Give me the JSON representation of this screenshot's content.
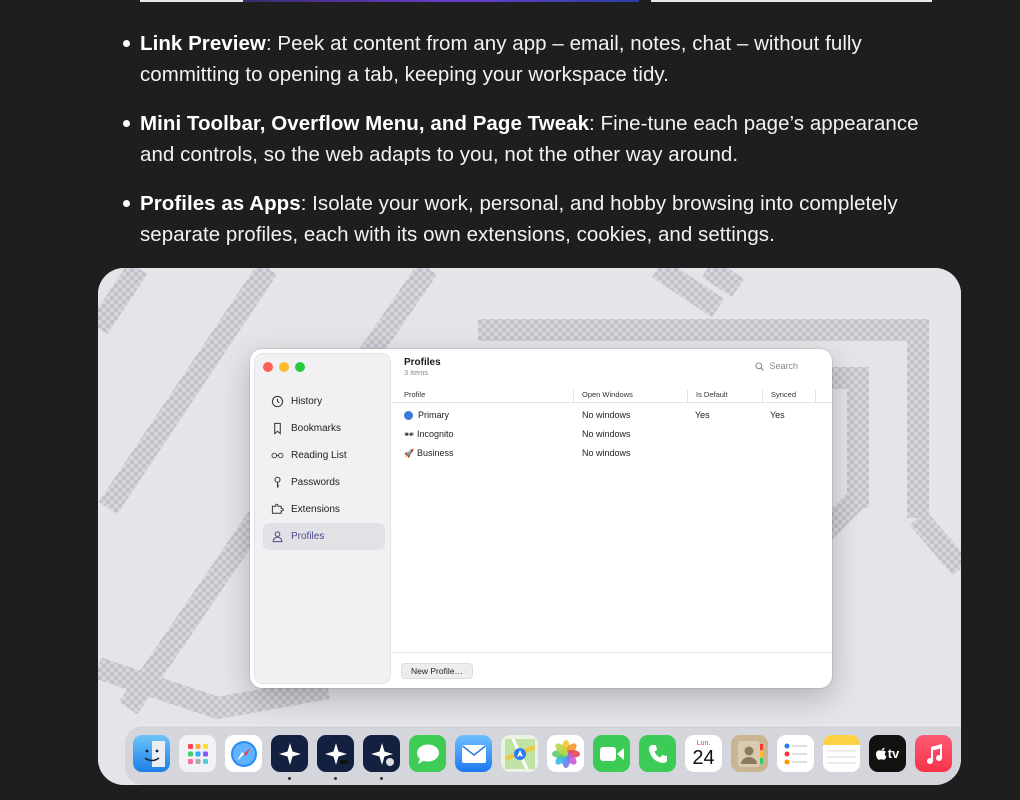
{
  "features": [
    {
      "title": "Link Preview",
      "text": ": Peek at content from any app – email, notes, chat – without fully committing to opening a tab, keeping your workspace tidy."
    },
    {
      "title": "Mini Toolbar, Overflow Menu, and Page Tweak",
      "text": ": Fine-tune each page’s appearance and controls, so the web adapts to you, not the other way around."
    },
    {
      "title": "Profiles as Apps",
      "text": ": Isolate your work, personal, and hobby browsing into completely separate profiles, each with its own extensions, cookies, and settings."
    }
  ],
  "window": {
    "sidebar": [
      {
        "label": "History",
        "icon": "clock-icon"
      },
      {
        "label": "Bookmarks",
        "icon": "bookmark-icon"
      },
      {
        "label": "Reading List",
        "icon": "glasses-icon"
      },
      {
        "label": "Passwords",
        "icon": "key-icon"
      },
      {
        "label": "Extensions",
        "icon": "puzzle-icon"
      },
      {
        "label": "Profiles",
        "icon": "person-icon",
        "active": true
      }
    ],
    "title": "Profiles",
    "subtitle": "3 items",
    "search_placeholder": "Search",
    "columns": [
      "Profile",
      "Open Windows",
      "Is Default",
      "Synced"
    ],
    "rows": [
      {
        "icon": "blue-dot",
        "name": "Primary",
        "windows": "No windows",
        "is_default": "Yes",
        "synced": "Yes"
      },
      {
        "icon": "sunglasses-icon",
        "name": "Incognito",
        "windows": "No windows",
        "is_default": "",
        "synced": ""
      },
      {
        "icon": "rocket-icon",
        "name": "Business",
        "windows": "No windows",
        "is_default": "",
        "synced": ""
      }
    ],
    "new_button": "New Profile…"
  },
  "dock": {
    "apps": [
      "Finder",
      "Launchpad",
      "Safari",
      "Browser",
      "Browser Incognito",
      "Browser Business",
      "Messages",
      "Mail",
      "Maps",
      "Photos",
      "FaceTime",
      "Phone",
      "Calendar",
      "Contacts",
      "Reminders",
      "Notes",
      "TV",
      "Music"
    ],
    "calendar_month": "Lun.",
    "calendar_day": "24",
    "tv_label": "tv"
  },
  "colors": {
    "background": "#1e1e1f",
    "accent": "#4a4a8e",
    "primary_dot": "#3d7ad6"
  }
}
